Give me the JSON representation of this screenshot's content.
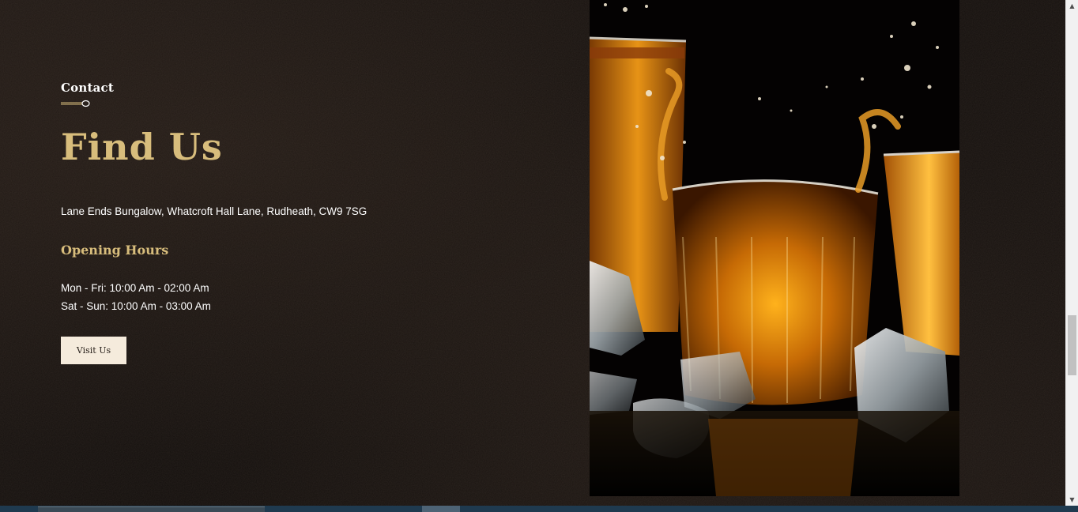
{
  "section": {
    "subtitle": "Contact",
    "title": "Find Us",
    "address": "Lane Ends Bungalow, Whatcroft Hall Lane, Rudheath, CW9 7SG",
    "hours_heading": "Opening Hours",
    "hours": [
      "Mon - Fri: 10:00 Am - 02:00 Am",
      "Sat - Sun: 10:00 Am - 03:00 Am"
    ],
    "button_label": "Visit Us"
  },
  "colors": {
    "accent_gold": "#d8bd7c",
    "background": "#151110",
    "button_bg": "#f5ebdc",
    "text": "#ffffff"
  },
  "icons": {
    "divider": "spoon-divider-icon",
    "scroll_up": "chevron-up-icon",
    "scroll_down": "chevron-down-icon"
  },
  "scroll": {
    "position_fraction": 0.72
  }
}
